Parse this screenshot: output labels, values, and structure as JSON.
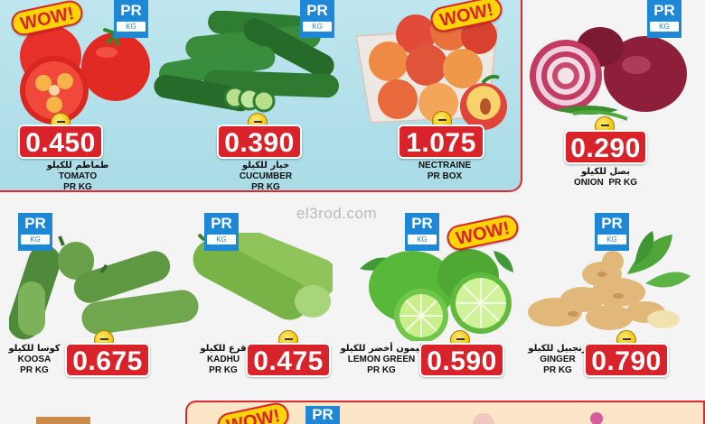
{
  "colors": {
    "price_red": "#d8232a",
    "badge_blue": "#1e88d6",
    "panel_cyan": "#bfe6ee",
    "wow_yellow": "#ffd400"
  },
  "badge": {
    "pr": "PR",
    "kg": "KG"
  },
  "wow_text": "WOW!",
  "watermark": "el3rod.com",
  "products": {
    "tomato": {
      "price": "0.450",
      "ar": "طماطم للكيلو",
      "en": "TOMATO",
      "unit": "PR KG"
    },
    "cucumber": {
      "price": "0.390",
      "ar": "خيار للكيلو",
      "en": "CUCUMBER",
      "unit": "PR KG"
    },
    "nectarine": {
      "price": "1.075",
      "en": "NECTRAINE",
      "unit": "PR BOX"
    },
    "onion": {
      "price": "0.290",
      "ar": "بصل للكيلو",
      "en": "ONION",
      "unit": "PR KG"
    },
    "koosa": {
      "price": "0.675",
      "ar": "كوسا للكيلو",
      "en": "KOOSA",
      "unit": "PR KG"
    },
    "kadhu": {
      "price": "0.475",
      "ar": "قرع للكيلو",
      "en": "KADHU",
      "unit": "PR KG"
    },
    "lemon_green": {
      "price": "0.590",
      "ar": "ليمون أخضر للكيلو",
      "en": "LEMON GREEN",
      "unit": "PR KG"
    },
    "ginger": {
      "price": "0.790",
      "ar": "زنجبيل للكيلو",
      "en": "GINGER",
      "unit": "PR KG"
    }
  }
}
